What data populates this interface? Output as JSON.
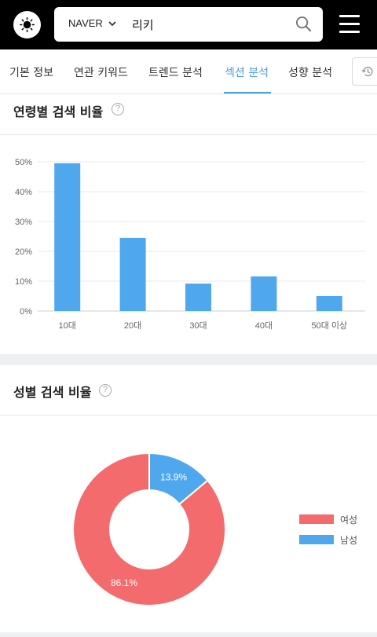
{
  "header": {
    "search_engine": "NAVER",
    "query": "리키"
  },
  "tabs": [
    {
      "label": "기본 정보"
    },
    {
      "label": "연관 키워드"
    },
    {
      "label": "트렌드 분석"
    },
    {
      "label": "섹션 분석"
    },
    {
      "label": "성향 분석"
    }
  ],
  "active_tab": "섹션 분석",
  "age_section": {
    "title": "연령별 검색 비율",
    "help": "?"
  },
  "gender_section": {
    "title": "성별 검색 비율",
    "help": "?",
    "legend": [
      {
        "label": "여성",
        "color": "#f46b6d"
      },
      {
        "label": "남성",
        "color": "#4fa7ee"
      }
    ]
  },
  "chart_data": [
    {
      "type": "bar",
      "categories": [
        "10대",
        "20대",
        "30대",
        "40대",
        "50대 이상"
      ],
      "values": [
        49.5,
        24.5,
        9.2,
        11.6,
        5.0
      ],
      "ylim": [
        0,
        50
      ],
      "yticks": [
        "0%",
        "10%",
        "20%",
        "30%",
        "40%",
        "50%"
      ],
      "grid": true,
      "color": "#4fa7ee"
    },
    {
      "type": "pie",
      "donut": true,
      "categories": [
        "남성",
        "여성"
      ],
      "values": [
        13.9,
        86.1
      ],
      "labels": [
        "13.9%",
        "86.1%"
      ],
      "colors": [
        "#4fa7ee",
        "#f46b6d"
      ],
      "legend": "right"
    }
  ]
}
